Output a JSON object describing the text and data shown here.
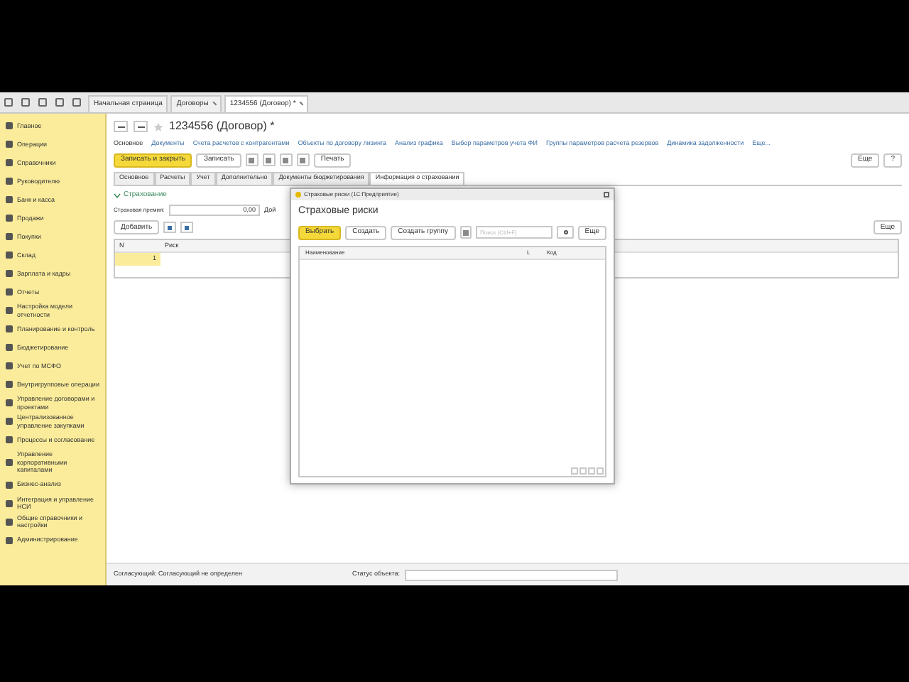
{
  "top_tabs": [
    {
      "label": "Начальная страница",
      "closable": false,
      "selected": false
    },
    {
      "label": "Договоры",
      "closable": true,
      "selected": false
    },
    {
      "label": "1234556 (Договор) *",
      "closable": true,
      "selected": true
    }
  ],
  "sidebar": {
    "items": [
      {
        "label": "Главное"
      },
      {
        "label": "Операции"
      },
      {
        "label": "Справочники"
      },
      {
        "label": "Руководителю"
      },
      {
        "label": "Банк и касса"
      },
      {
        "label": "Продажи"
      },
      {
        "label": "Покупки"
      },
      {
        "label": "Склад"
      },
      {
        "label": "Зарплата и кадры"
      },
      {
        "label": "Отчеты"
      },
      {
        "label": "Настройка модели отчетности"
      },
      {
        "label": "Планирование и контроль"
      },
      {
        "label": "Бюджетирование"
      },
      {
        "label": "Учет по МСФО"
      },
      {
        "label": "Внутригрупповые операции"
      },
      {
        "label": "Управление договорами и проектами"
      },
      {
        "label": "Централизованное управление закупками"
      },
      {
        "label": "Процессы и согласование"
      },
      {
        "label": "Управление корпоративными капиталами"
      },
      {
        "label": "Бизнес-анализ"
      },
      {
        "label": "Интеграция и управление НСИ"
      },
      {
        "label": "Общие справочники и настройки"
      },
      {
        "label": "Администрирование"
      }
    ]
  },
  "form": {
    "title": "1234556 (Договор) *",
    "nav_links": [
      {
        "label": "Основное",
        "selected": true
      },
      {
        "label": "Документы",
        "selected": false
      },
      {
        "label": "Счета расчетов с контрагентами",
        "selected": false
      },
      {
        "label": "Объекты по договору лизинга",
        "selected": false
      },
      {
        "label": "Анализ графика",
        "selected": false
      },
      {
        "label": "Выбор параметров учета ФИ",
        "selected": false
      },
      {
        "label": "Группы параметров расчета резервов",
        "selected": false
      },
      {
        "label": "Динамика задолженности",
        "selected": false
      },
      {
        "label": "Еще...",
        "selected": false
      }
    ],
    "toolbar": {
      "primary": "Записать и закрыть",
      "save": "Записать",
      "print": "Печать",
      "more": "Еще",
      "help": "?"
    },
    "tabs": [
      {
        "label": "Основное",
        "selected": false
      },
      {
        "label": "Расчеты",
        "selected": false
      },
      {
        "label": "Учет",
        "selected": false
      },
      {
        "label": "Дополнительно",
        "selected": false
      },
      {
        "label": "Документы бюджетирования",
        "selected": false
      },
      {
        "label": "Информация о страховании",
        "selected": true
      }
    ],
    "section": {
      "title": "Страхование",
      "expanded": true
    },
    "premium": {
      "label": "Страховая премия:",
      "value": "0,00",
      "next_label": "Дой"
    },
    "add_button": "Добавить",
    "more_button": "Еще",
    "table": {
      "columns": [
        "N",
        "Риск"
      ],
      "rows": [
        {
          "n": "1",
          "risk": "",
          "selected": true
        }
      ]
    }
  },
  "dialog": {
    "window_title": "Страховые риски (1С:Предприятие)",
    "title": "Страховые риски",
    "buttons": {
      "choose": "Выбрать",
      "create": "Создать",
      "create_group": "Создать группу",
      "more": "Еще"
    },
    "search": {
      "placeholder": "Поиск (Ctrl+F)"
    },
    "columns": [
      "Наименование",
      "L",
      "Код"
    ]
  },
  "status_bar": {
    "approver": "Согласующий: Согласующий не определен",
    "status_label": "Статус объекта:"
  }
}
